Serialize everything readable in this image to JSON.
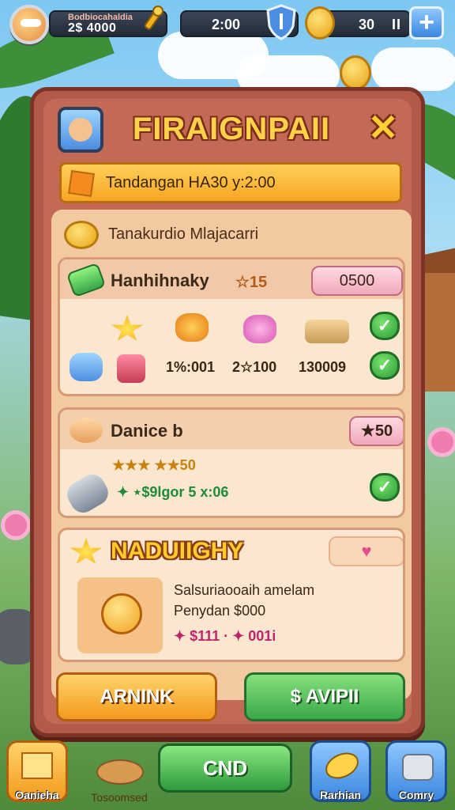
{
  "hud": {
    "player_title": "Bodbiocahaldia",
    "player_value": "2$ 4000",
    "time": "2:00",
    "coin_amount": "30",
    "pause": "II",
    "plus": "+"
  },
  "panel": {
    "title": "FIRAIGNPAII",
    "close": "✕",
    "banner": "Tandangan HA30 y:2:00",
    "coins_row": "Tanakurdio Mlajacarri",
    "card1": {
      "title": "Hanhihnaky",
      "badge": "☆15",
      "price": "0500",
      "labels": [
        "1%:001",
        "2☆100",
        "130009"
      ]
    },
    "card2": {
      "title": "Danice b",
      "price": "★50",
      "stars": "★★★ ★★50",
      "reward": "✦ ⋆$9lgor 5 x:06"
    },
    "card3": {
      "title": "NADUIIGHY",
      "line1": "Salsuriaooaih amelam",
      "line2": "Penydan $000",
      "line3": "✦ $111 · ✦ 001i"
    },
    "btn_left": "ARNINK",
    "btn_right": "$ AVIPII"
  },
  "bottom": {
    "left_label": "Oanieha",
    "stack_label": "Tosoomsed",
    "center": "CND",
    "right1_label": "Rarhian",
    "right2_label": "Comry"
  },
  "icons": [
    "avatar-icon",
    "key-icon",
    "shield-icon",
    "coin-icon",
    "plus-icon",
    "close-icon",
    "star-icon",
    "check-icon",
    "heart-icon",
    "sun-icon"
  ],
  "colors": {
    "panel": "#b35b4a",
    "banner": "#f6a623",
    "green": "#3aa84a",
    "orange": "#f39a1c",
    "gold": "#ffd24a"
  }
}
